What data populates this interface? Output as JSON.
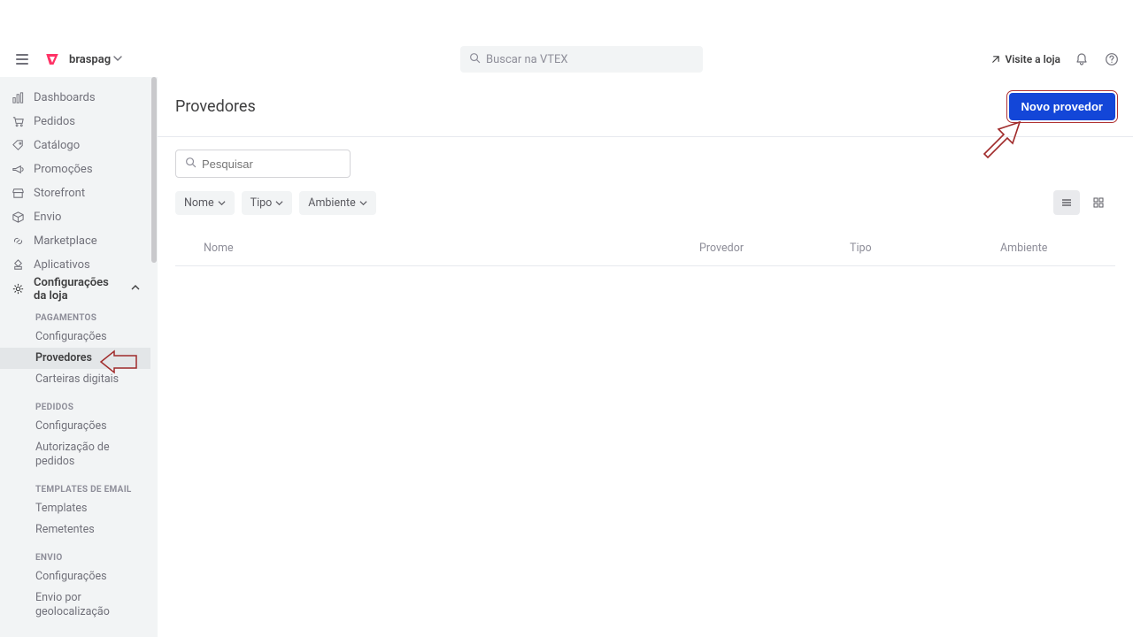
{
  "header": {
    "account_name": "braspag",
    "search_placeholder": "Buscar na VTEX",
    "visit_store": "Visite a loja"
  },
  "sidebar": {
    "top": [
      {
        "icon": "dashboard",
        "label": "Dashboards"
      },
      {
        "icon": "cart",
        "label": "Pedidos"
      },
      {
        "icon": "tag",
        "label": "Catálogo"
      },
      {
        "icon": "megaphone",
        "label": "Promoções"
      },
      {
        "icon": "storefront",
        "label": "Storefront"
      },
      {
        "icon": "box",
        "label": "Envio"
      },
      {
        "icon": "link",
        "label": "Marketplace"
      },
      {
        "icon": "apps",
        "label": "Aplicativos"
      },
      {
        "icon": "gear",
        "label": "Configurações da loja"
      }
    ],
    "sections": [
      {
        "heading": "PAGAMENTOS",
        "items": [
          "Configurações",
          "Provedores",
          "Carteiras digitais"
        ],
        "active_index": 1
      },
      {
        "heading": "PEDIDOS",
        "items": [
          "Configurações",
          "Autorização de pedidos"
        ]
      },
      {
        "heading": "TEMPLATES DE EMAIL",
        "items": [
          "Templates",
          "Remetentes"
        ]
      },
      {
        "heading": "ENVIO",
        "items": [
          "Configurações",
          "Envio por geolocalização"
        ]
      }
    ]
  },
  "page": {
    "title": "Provedores",
    "primary_button": "Novo provedor",
    "search_placeholder": "Pesquisar",
    "filters": [
      "Nome",
      "Tipo",
      "Ambiente"
    ],
    "columns": {
      "nome": "Nome",
      "provedor": "Provedor",
      "tipo": "Tipo",
      "ambiente": "Ambiente"
    }
  }
}
